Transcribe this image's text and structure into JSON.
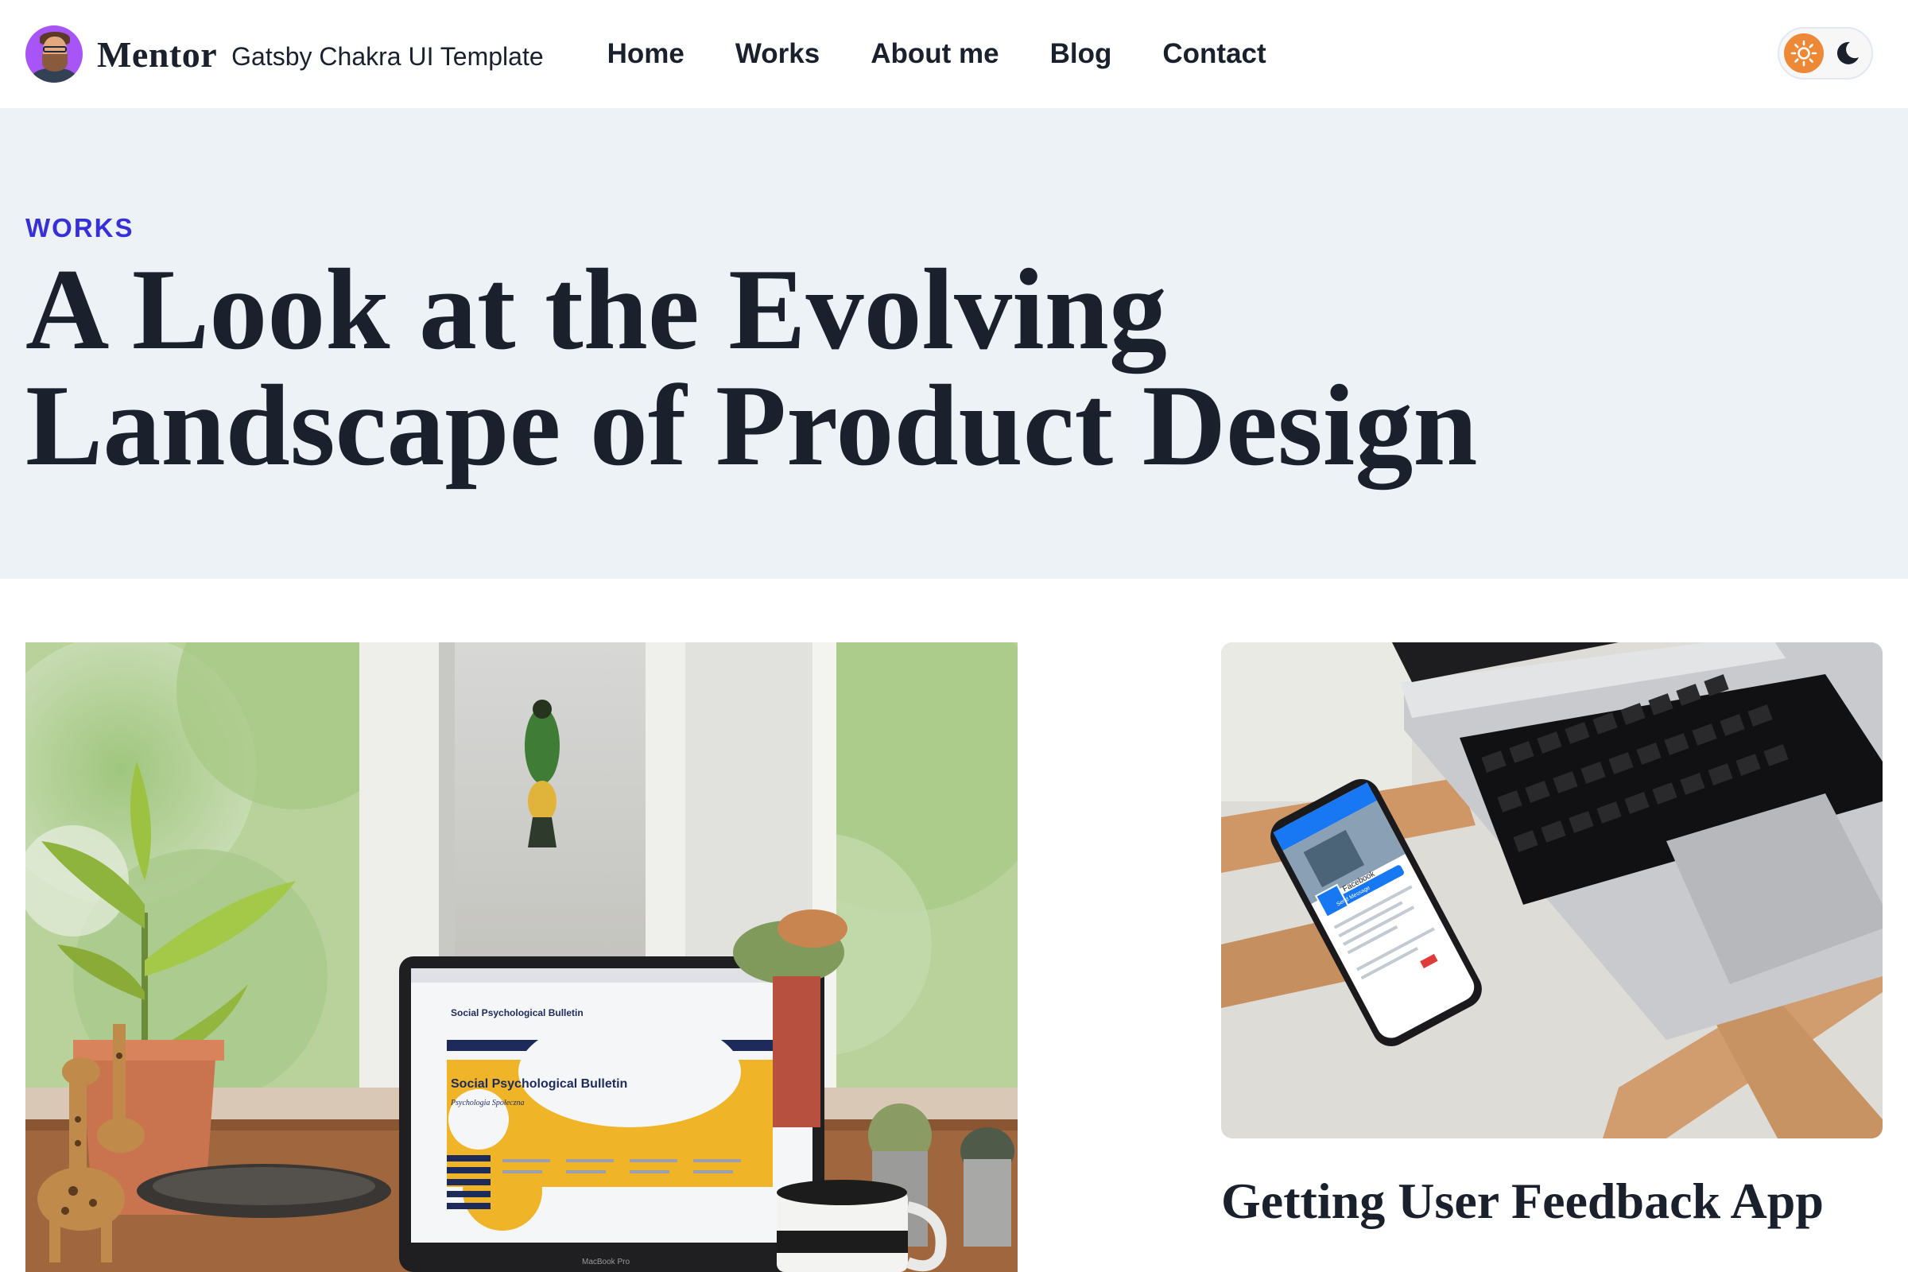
{
  "header": {
    "brand_name": "Mentor",
    "brand_tagline": "Gatsby Chakra UI Template",
    "nav": [
      {
        "label": "Home"
      },
      {
        "label": "Works"
      },
      {
        "label": "About me"
      },
      {
        "label": "Blog"
      },
      {
        "label": "Contact"
      }
    ],
    "theme_toggle": {
      "light_icon": "sun-icon",
      "dark_icon": "moon-icon",
      "active": "light"
    }
  },
  "hero": {
    "eyebrow": "WORKS",
    "title": "A Look at the Evolving Landscape of Product Design"
  },
  "cards": [
    {
      "image": "laptop-on-windowsill-with-plants",
      "title": "",
      "screen_text": {
        "headline": "Social Psychological Bulletin",
        "subtitle": "Psychologia Społeczna",
        "bezel": "MacBook Pro"
      }
    },
    {
      "image": "laptop-and-phone-on-desk",
      "title": "Getting User Feedback App",
      "phone_text": {
        "app": "Facebook",
        "button": "Send Message"
      }
    }
  ],
  "colors": {
    "accent": "#3730d9",
    "hero_bg": "#edf2f7",
    "text": "#1a202c",
    "toggle_sun": "#ed8936"
  }
}
